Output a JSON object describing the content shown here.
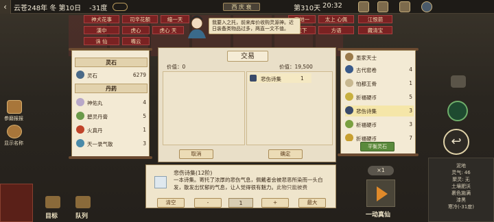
{
  "topbar": {
    "back": "‹",
    "date": "云苍248年 冬 第10日",
    "temp": "-31度",
    "region": "西 庆 衰",
    "day": "第310天",
    "time": "20:32"
  },
  "rank_tiles": [
    "神犬花事",
    "司辛花额",
    "缩一天",
    "天地一",
    "太上 心佩",
    "江恨箭",
    "漢中",
    "虎心",
    "虎心 天",
    "天下",
    "方语",
    "藏清宝",
    "诛 仙",
    "嘴云"
  ],
  "dialog": "我要入之托，前来库价收购灵源神。近日装备类物品过多，两直一文不值。",
  "left_panel": {
    "categories": [
      {
        "head": "灵石",
        "items": [
          {
            "name": "灵石",
            "qty": "6279",
            "icon_color": "#4a6a88"
          }
        ]
      },
      {
        "head": "丹药",
        "items": [
          {
            "name": "神佑丸",
            "qty": "4",
            "icon_color": "#b8a8c8"
          },
          {
            "name": "碧灵丹膏",
            "qty": "5",
            "icon_color": "#6a9a4a"
          },
          {
            "name": "火真丹",
            "qty": "1",
            "icon_color": "#c0442a"
          },
          {
            "name": "天一录气散",
            "qty": "3",
            "icon_color": "#4a8aa8"
          }
        ]
      }
    ]
  },
  "trade": {
    "title": "交易",
    "value_left": "价值：0",
    "value_right": "价值：19,500",
    "sell_item": {
      "name": "悲伤诗集",
      "qty": "1"
    },
    "cancel_label": "取消",
    "confirm_label": "确定"
  },
  "right_panel": {
    "items": [
      {
        "name": "墨家天士",
        "qty": "",
        "icon_color": "#9a7a4a"
      },
      {
        "name": "古代窑卷",
        "qty": "4",
        "icon_color": "#3a5a8a"
      },
      {
        "name": "怕都王骨",
        "qty": "1",
        "icon_color": "#c8b890"
      },
      {
        "name": "折福硬币",
        "qty": "5",
        "icon_color": "#c8b040"
      },
      {
        "name": "悲伤诗集",
        "qty": "3",
        "icon_color": "#3a4a6a"
      },
      {
        "name": "析福硬币",
        "qty": "3",
        "icon_color": "#7aa040"
      },
      {
        "name": "折福硬币",
        "qty": "7",
        "icon_color": "#c8a030"
      }
    ],
    "balance_label": "平衡灵石"
  },
  "description": {
    "title": "悲伤诗集(12阶)",
    "text": "一本诗集。寄托了浓厚的悲伤气息，佩戴者会被悲恶所染而一头白发，散发出忧郁的气息，让人觉得很有魅力。",
    "cut_text": "此物只能被费",
    "clear_label": "清空",
    "minus_label": "-",
    "qty_value": "1",
    "plus_label": "+",
    "max_label": "最大"
  },
  "side_left": [
    {
      "label": "参磨报报"
    },
    {
      "label": "显示名称"
    }
  ],
  "bottom_left": {
    "target_label": "目标",
    "team_label": "队列"
  },
  "right_controls": {
    "speed": "×1",
    "play_label": "一动真仙"
  },
  "info_card": [
    "泥地",
    "灵气: 46",
    "聚灵: 无",
    "土壤肥沃",
    "裹色施满",
    "漆黑",
    "寒冷(-31度)"
  ]
}
